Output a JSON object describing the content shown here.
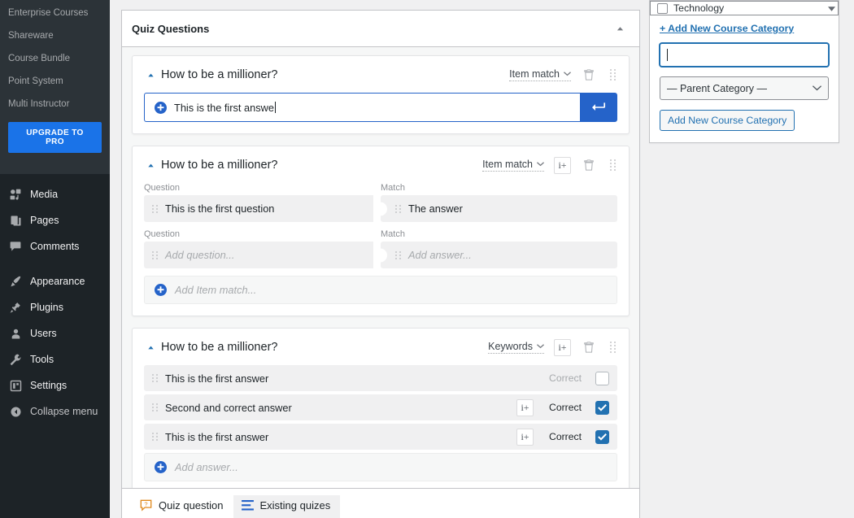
{
  "sidebar": {
    "submenu_items": [
      {
        "label": "Enterprise Courses"
      },
      {
        "label": "Shareware"
      },
      {
        "label": "Course Bundle"
      },
      {
        "label": "Point System"
      },
      {
        "label": "Multi Instructor"
      }
    ],
    "upgrade_label": "UPGRADE TO PRO",
    "menu_items": [
      {
        "label": "Media",
        "icon": "media-icon"
      },
      {
        "label": "Pages",
        "icon": "pages-icon"
      },
      {
        "label": "Comments",
        "icon": "comments-icon"
      },
      {
        "label": "Appearance",
        "icon": "appearance-icon"
      },
      {
        "label": "Plugins",
        "icon": "plugins-icon"
      },
      {
        "label": "Users",
        "icon": "users-icon"
      },
      {
        "label": "Tools",
        "icon": "tools-icon"
      },
      {
        "label": "Settings",
        "icon": "settings-icon"
      },
      {
        "label": "Collapse menu",
        "icon": "collapse-icon"
      }
    ]
  },
  "panel": {
    "title": "Quiz Questions",
    "toggle_icon": "chevron-up-icon"
  },
  "questions": [
    {
      "title": "How to be a millioner?",
      "type_label": "Item match",
      "has_info_button": false,
      "info_label": "i+",
      "answer_input": {
        "value": "This is the first answe",
        "submit_icon": "enter-arrow-icon",
        "plus_icon": "plus-circle-icon"
      }
    },
    {
      "title": "How to be a millioner?",
      "type_label": "Item match",
      "has_info_button": true,
      "info_label": "i+",
      "question_column_label": "Question",
      "match_column_label": "Match",
      "pairs": [
        {
          "question": "This is the first question",
          "match": "The answer",
          "placeholder": false
        },
        {
          "question": "Add question...",
          "match": "Add answer...",
          "placeholder": true
        }
      ],
      "add_row_label": "Add Item match..."
    },
    {
      "title": "How to be a millioner?",
      "type_label": "Keywords",
      "has_info_button": true,
      "info_label": "i+",
      "answers": [
        {
          "text": "This is the first answer",
          "correct_label": "Correct",
          "correct": false,
          "has_info": false
        },
        {
          "text": "Second and correct answer",
          "correct_label": "Correct",
          "correct": true,
          "has_info": true
        },
        {
          "text": "This is the first answer",
          "correct_label": "Correct",
          "correct": true,
          "has_info": true
        }
      ],
      "add_row_label": "Add answer..."
    }
  ],
  "tabs": [
    {
      "label": "Quiz question",
      "icon": "question-bubble-icon",
      "active": true
    },
    {
      "label": "Existing quizes",
      "icon": "list-lines-icon",
      "active": false
    }
  ],
  "right_panel": {
    "category_item": "Technology",
    "add_new_link": "+ Add New Course Category",
    "new_category_value": "",
    "parent_select_value": "— Parent Category —",
    "add_button_label": "Add New Course Category"
  },
  "colors": {
    "wp_blue": "#2271b1",
    "accent_blue": "#2563c9",
    "sidebar_dark": "#1d2327",
    "sidebar_sub": "#2c3338",
    "orange": "#d98324"
  }
}
